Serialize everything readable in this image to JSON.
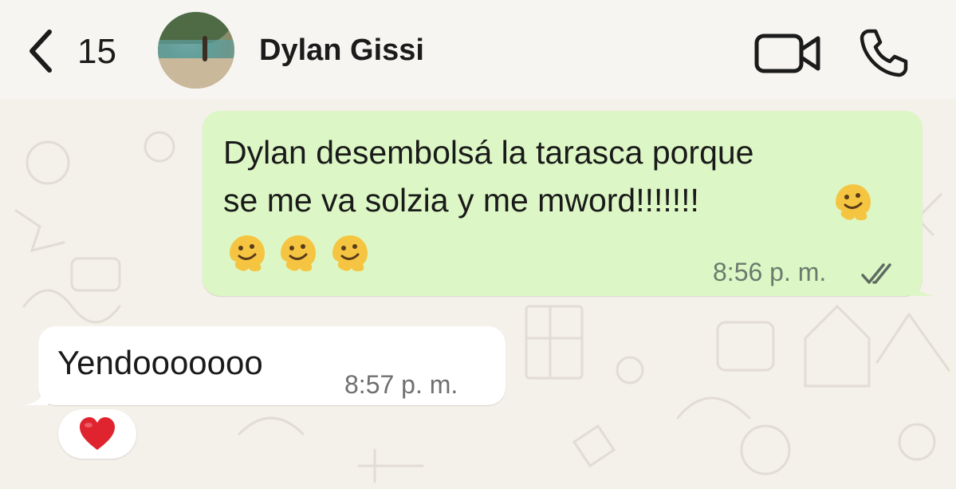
{
  "header": {
    "back_icon": "chevron-left-icon",
    "unread_count": "15",
    "contact_name": "Dylan Gissi",
    "video_icon": "video-camera-icon",
    "phone_icon": "phone-icon"
  },
  "messages": [
    {
      "direction": "outgoing",
      "text": "Dylan desembolsá la tarasca porque\nse me va solzia y me mword!!!!!!!",
      "emojis": [
        "melting-face",
        "melting-face",
        "melting-face",
        "melting-face"
      ],
      "time": "8:56 p. m.",
      "status": "read-ticks"
    },
    {
      "direction": "incoming",
      "text": "Yendooooooo",
      "time": "8:57 p. m.",
      "reaction": "❤️"
    }
  ],
  "colors": {
    "outgoing_bubble": "#dcf7c5",
    "incoming_bubble": "#ffffff",
    "wallpaper": "#f4f0ea"
  }
}
